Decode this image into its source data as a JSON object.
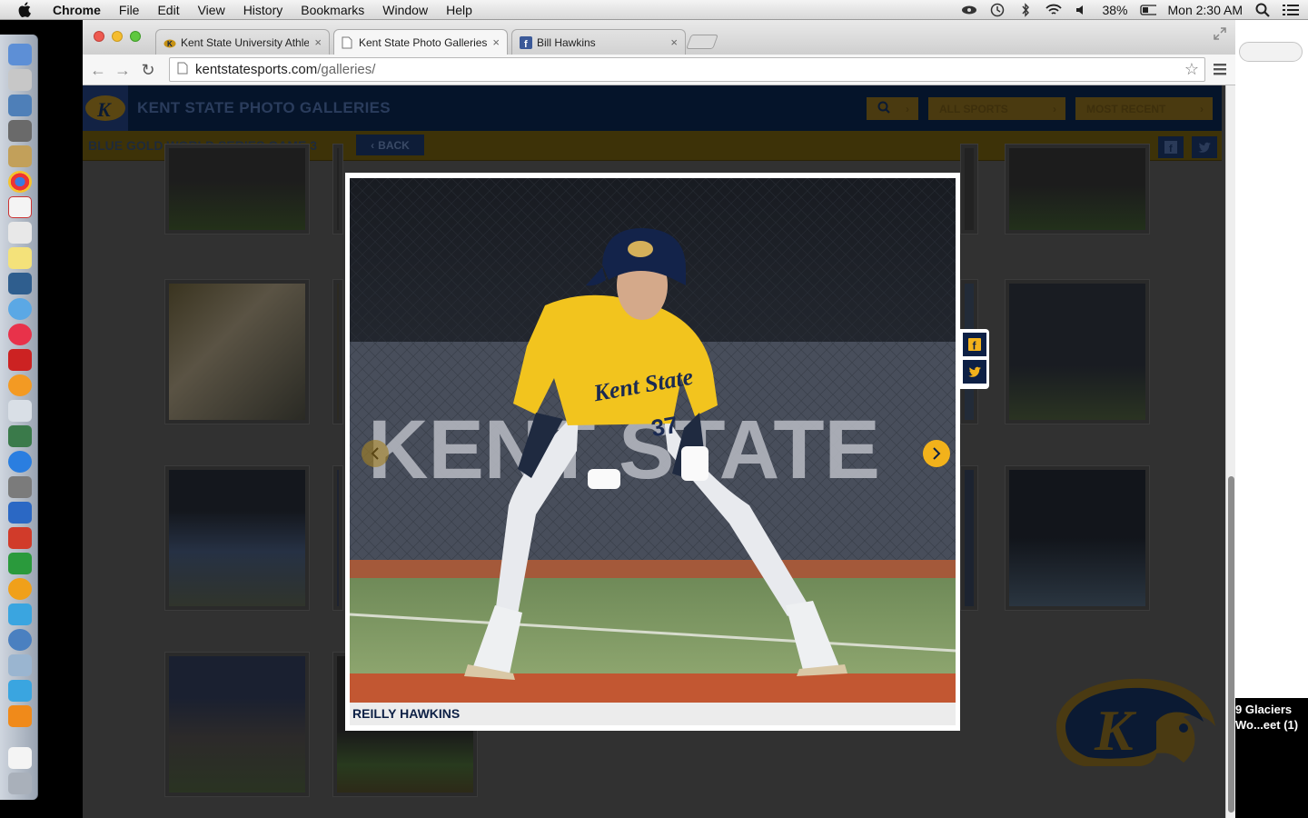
{
  "menubar": {
    "app_name": "Chrome",
    "menus": [
      "File",
      "Edit",
      "View",
      "History",
      "Bookmarks",
      "Window",
      "Help"
    ],
    "battery": "38%",
    "clock": "Mon 2:30 AM"
  },
  "browser": {
    "tabs": [
      {
        "title": "Kent State University Athle",
        "favicon": "golden-flashes-icon"
      },
      {
        "title": "Kent State Photo Galleries",
        "favicon": "page-icon"
      },
      {
        "title": "Bill Hawkins",
        "favicon": "facebook-icon"
      }
    ],
    "url_host": "kentstatesports.com",
    "url_path": "/galleries/"
  },
  "site": {
    "title": "KENT STATE PHOTO GALLERIES",
    "filters": [
      "ALL SPORTS",
      "MOST RECENT"
    ],
    "gallery_title": "BLUE GOLD WORLD SERIES GAME 3",
    "back_label": "BACK"
  },
  "lightbox": {
    "caption": "REILLY HAWKINS",
    "jersey_text": "Kent State",
    "jersey_number": "37",
    "banner_text": "KENT STATE"
  },
  "notification": {
    "line1": "9 Glaciers",
    "line2": "Wo...eet (1)"
  },
  "colors": {
    "navy": "#0d2045",
    "gold": "#f2b21b"
  }
}
